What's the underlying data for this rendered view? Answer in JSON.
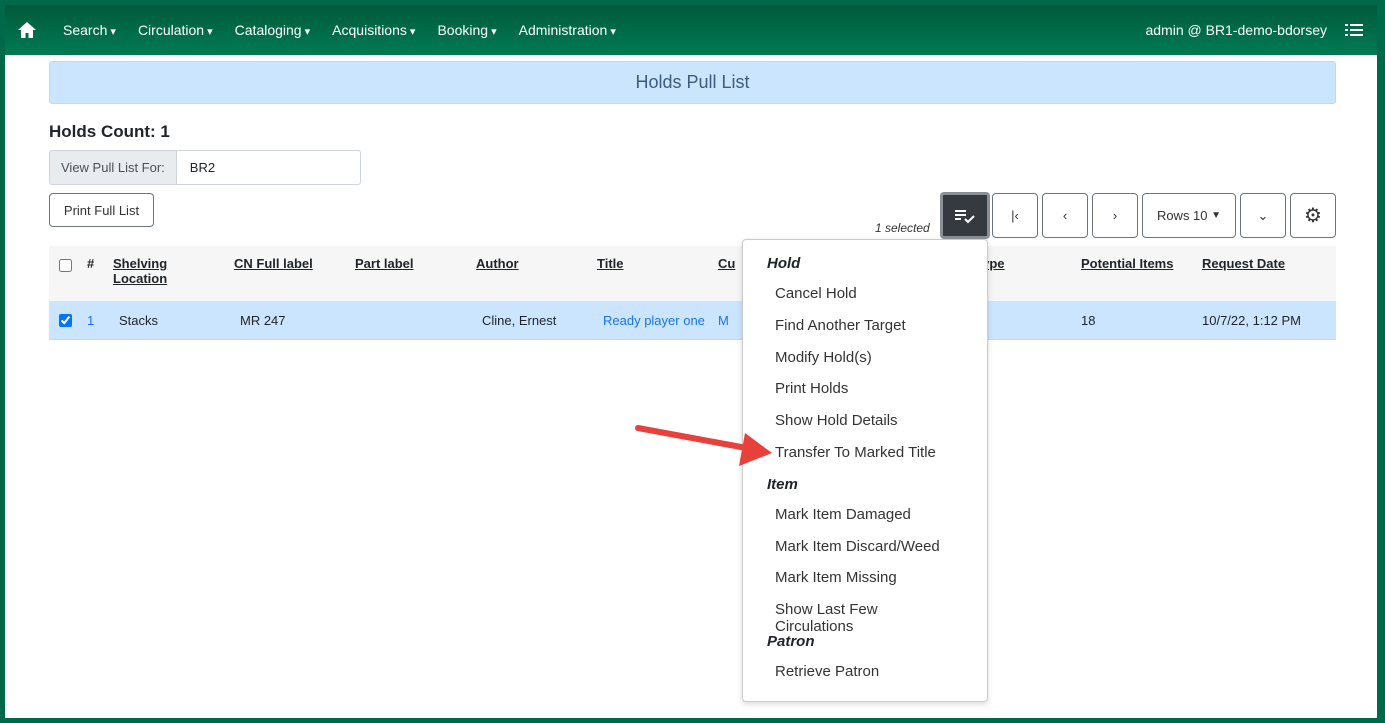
{
  "nav": {
    "items": [
      "Search",
      "Circulation",
      "Cataloging",
      "Acquisitions",
      "Booking",
      "Administration"
    ],
    "user": "admin @ BR1-demo-bdorsey"
  },
  "page_title": "Holds Pull List",
  "holds_count": "Holds Count: 1",
  "pull_list": {
    "label": "View Pull List For:",
    "value": "BR2"
  },
  "print_label": "Print Full List",
  "selected_text": "1 selected",
  "rows_label": "Rows 10",
  "columns": [
    "#",
    "Shelving Location",
    "CN Full label",
    "Part label",
    "Author",
    "Title",
    "Cu",
    "ld Type",
    "Potential Items",
    "Request Date"
  ],
  "row": {
    "num": "1",
    "shelving": "Stacks",
    "cn": "MR 247",
    "part": "",
    "author": "Cline, Ernest",
    "title": "Ready player one",
    "cu": "M",
    "potential": "18",
    "date": "10/7/22, 1:12 PM"
  },
  "menu": {
    "hold_header": "Hold",
    "hold": [
      "Cancel Hold",
      "Find Another Target",
      "Modify Hold(s)",
      "Print Holds",
      "Show Hold Details",
      "Transfer To Marked Title"
    ],
    "item_header": "Item",
    "item": [
      "Mark Item Damaged",
      "Mark Item Discard/Weed",
      "Mark Item Missing",
      "Show Last Few Circulations"
    ],
    "patron_header": "Patron",
    "patron": [
      "Retrieve Patron"
    ]
  },
  "colors": {
    "nav": "#006b47",
    "banner": "#cce5ff",
    "row": "#cce5ff",
    "arrow": "#e8403a",
    "link": "#1a73e8"
  }
}
